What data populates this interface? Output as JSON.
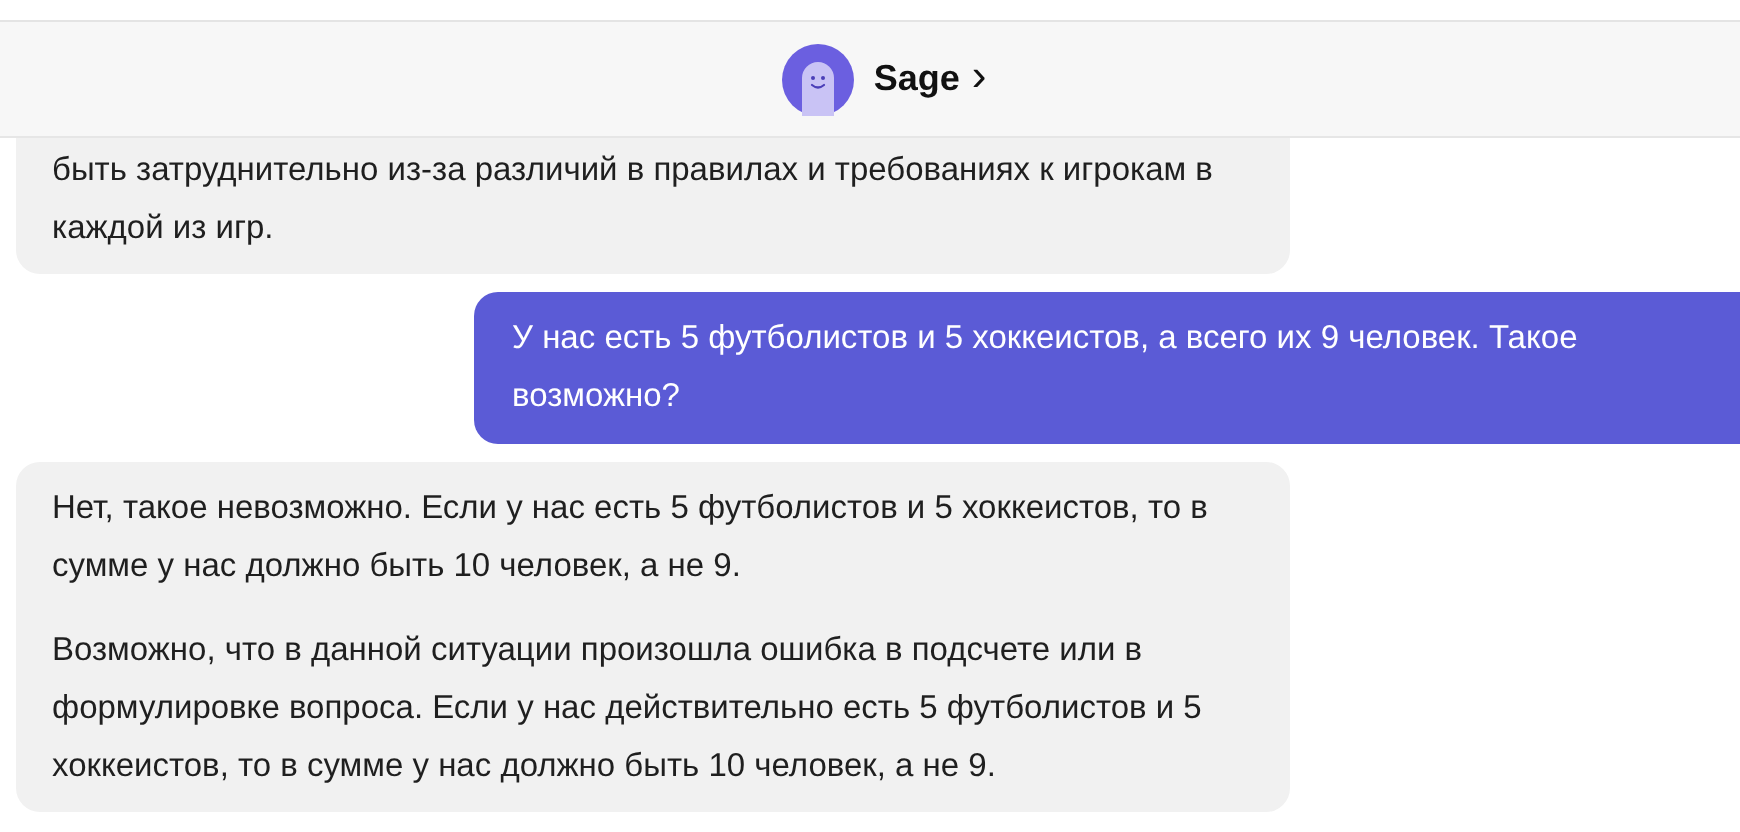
{
  "header": {
    "bot_name": "Sage",
    "chevron": "›"
  },
  "messages": [
    {
      "kind": "bot",
      "paragraphs": [
        "быть затруднительно из-за различий в правилах и требованиях к игрокам в каждой из игр."
      ]
    },
    {
      "kind": "user",
      "paragraphs": [
        "У нас есть 5 футболистов и 5 хоккеистов, а всего их 9 человек. Такое возможно?"
      ]
    },
    {
      "kind": "bot",
      "paragraphs": [
        "Нет, такое невозможно. Если у нас есть 5 футболистов и 5 хоккеистов, то в сумме у нас должно быть 10 человек, а не 9.",
        "Возможно, что в данной ситуации произошла ошибка в подсчете или в формулировке вопроса. Если у нас действительно есть 5 футболистов и 5 хоккеистов, то в сумме у нас должно быть 10 человек, а не 9."
      ]
    }
  ]
}
